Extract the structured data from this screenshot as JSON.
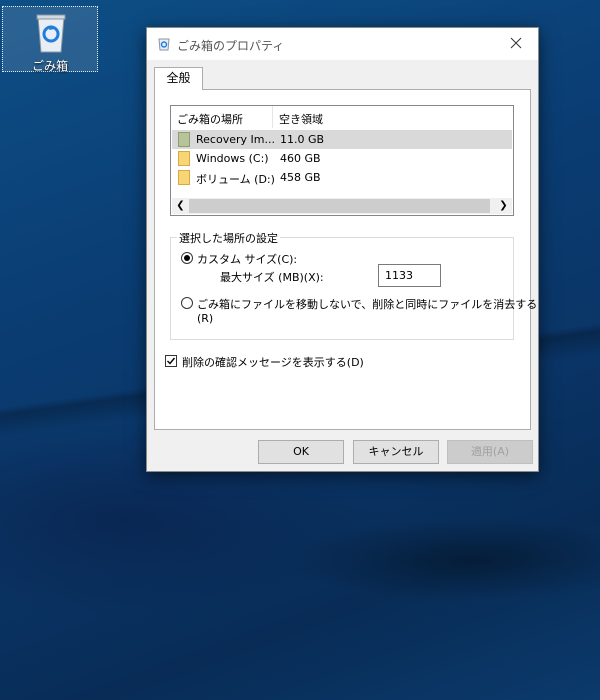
{
  "desktop": {
    "recycle_bin_label": "ごみ箱",
    "background_color": "#0a3d73"
  },
  "dialog": {
    "title": "ごみ箱のプロパティ",
    "tabs": [
      {
        "label": "全般",
        "active": true
      }
    ],
    "list": {
      "columns": [
        "ごみ箱の場所",
        "空き領域"
      ],
      "rows": [
        {
          "name": "Recovery Im...",
          "free": "11.0 GB",
          "selected": true,
          "icon": "drive-gray-icon"
        },
        {
          "name": "Windows (C:)",
          "free": "460 GB",
          "selected": false,
          "icon": "folder-icon"
        },
        {
          "name": "ボリューム (D:)",
          "free": "458 GB",
          "selected": false,
          "icon": "folder-icon"
        }
      ]
    },
    "settings": {
      "group_label": "選択した場所の設定",
      "custom_size_label": "カスタム サイズ(C):",
      "custom_size_selected": true,
      "max_size_label": "最大サイズ (MB)(X):",
      "max_size_value": "1133",
      "delete_immediately_label": "ごみ箱にファイルを移動しないで、削除と同時にファイルを消去する",
      "delete_immediately_label_suffix": "(R)",
      "delete_immediately_selected": false
    },
    "confirm_delete": {
      "label": "削除の確認メッセージを表示する(D)",
      "checked": true
    },
    "buttons": {
      "ok": "OK",
      "cancel": "キャンセル",
      "apply": "適用(A)"
    }
  }
}
